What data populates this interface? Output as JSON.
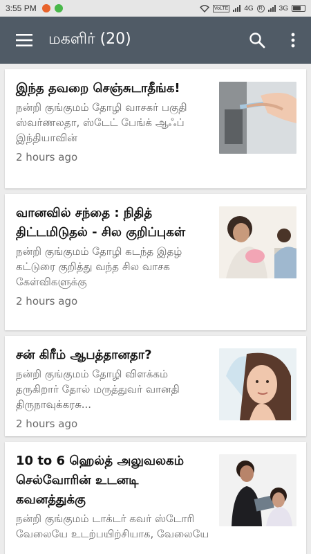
{
  "status_bar": {
    "time": "3:55 PM",
    "network_1": "4G",
    "network_2": "3G",
    "volte": "VoLTE",
    "roaming": "R",
    "icons": [
      "wifi-icon",
      "signal-icon",
      "battery-icon"
    ]
  },
  "app_bar": {
    "title": "மகளிர் (20)",
    "color": "#505b66"
  },
  "articles": [
    {
      "title": " இந்த தவறை செஞ்சுடாதீங்க!",
      "summary": "நன்றி குங்குமம் தோழி வாசகர் பகுதி ஸ்வர்ணலதா, ஸ்டேட் பேங்க் ஆஃப் இந்தியாவின்",
      "time": "2 hours ago"
    },
    {
      "title": " வானவில் சந்தை : நிதித் திட்டமிடுதல் - சில குறிப்புகள்",
      "summary": "நன்றி குங்குமம் தோழி கடந்த இதழ் கட்டுரை குறித்து வந்த சில வாசக கேள்விகளுக்கு",
      "time": "2 hours ago"
    },
    {
      "title": "சன் கிரீம் ஆபத்தானதா?",
      "summary": "நன்றி குங்குமம் தோழி விளக்கம் தருகிறார் தோல் மருத்துவர் வானதி திருநாவுக்கரசு...",
      "time": "2 hours ago"
    },
    {
      "title": "10 to 6 ஹெல்த் அலுவலகம் செல்வோரின் உடனடி கவனத்துக்கு",
      "summary": "நன்றி குங்குமம் டாக்டர் கவர் ஸ்டோரி வேலையே உடற்பயிற்சியாக, வேலையே",
      "time": ""
    }
  ]
}
